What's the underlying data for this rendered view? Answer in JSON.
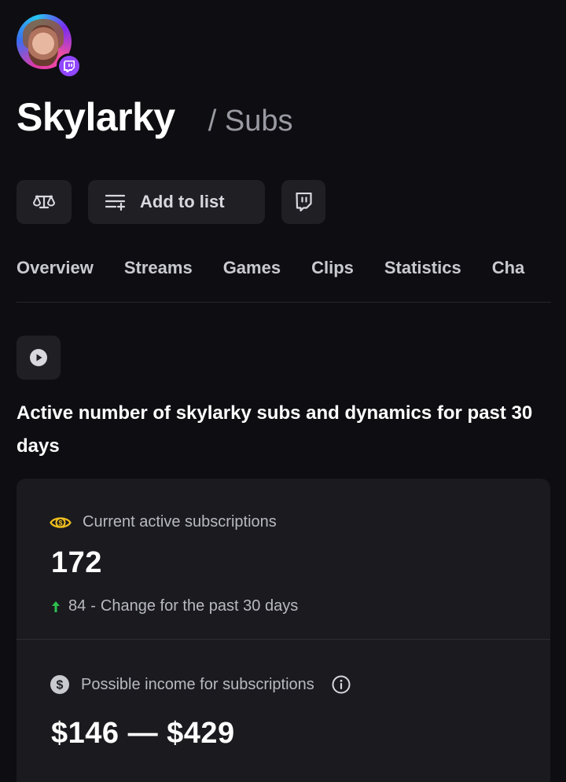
{
  "channel": {
    "name": "Skylarky",
    "section": "/ Subs",
    "platform_color": "#9146ff"
  },
  "actions": {
    "compare_icon": "scales-icon",
    "add_to_list_label": "Add to list",
    "twitch_icon": "twitch-icon"
  },
  "tabs": [
    {
      "label": "Overview"
    },
    {
      "label": "Streams"
    },
    {
      "label": "Games"
    },
    {
      "label": "Clips"
    },
    {
      "label": "Statistics"
    },
    {
      "label": "Cha"
    }
  ],
  "heading": "Active number of skylarky subs and dynamics for past 30 days",
  "subscriptions": {
    "label": "Current active subscriptions",
    "value": "172",
    "change_value": "84",
    "change_label": "Change for the past 30 days",
    "change_color": "#2fbf4f",
    "icon_color": "#f2c01e"
  },
  "income": {
    "label": "Possible income for subscriptions",
    "value": "$146 — $429"
  }
}
